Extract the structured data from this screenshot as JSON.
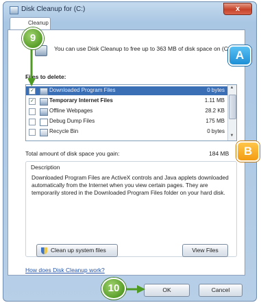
{
  "window": {
    "title": "Disk Cleanup for (C:)",
    "close_glyph": "x"
  },
  "tab": {
    "label": "Cleanup"
  },
  "intro": {
    "text": "You can use Disk Cleanup to free up to 363 MB of disk space on (C:)."
  },
  "files": {
    "label": "Files to delete:",
    "items": [
      {
        "checked": true,
        "name": "Downloaded Program Files",
        "size": "0 bytes"
      },
      {
        "checked": true,
        "name": "Temporary Internet Files",
        "size": "1.11 MB"
      },
      {
        "checked": false,
        "name": "Offline Webpages",
        "size": "28.2 KB"
      },
      {
        "checked": false,
        "name": "Debug Dump Files",
        "size": "175 MB"
      },
      {
        "checked": false,
        "name": "Recycle Bin",
        "size": "0 bytes"
      }
    ]
  },
  "total": {
    "label": "Total amount of disk space you gain:",
    "value": "184 MB"
  },
  "description": {
    "title": "Description",
    "text": "Downloaded Program Files are ActiveX controls and Java applets downloaded automatically from the Internet when you view certain pages. They are temporarily stored in the Downloaded Program Files folder on your hard disk."
  },
  "buttons": {
    "cleanup_system": "Clean up system files",
    "view_files": "View Files",
    "ok": "OK",
    "cancel": "Cancel"
  },
  "help_link": "How does Disk Cleanup work?",
  "callouts": {
    "step9": "9",
    "step10": "10",
    "a": "A",
    "b": "B"
  },
  "colors": {
    "green_badge": "#5a9f2a",
    "blue_badge": "#1f8fd6",
    "orange_badge": "#f39c12",
    "selection": "#3b6fb5"
  }
}
